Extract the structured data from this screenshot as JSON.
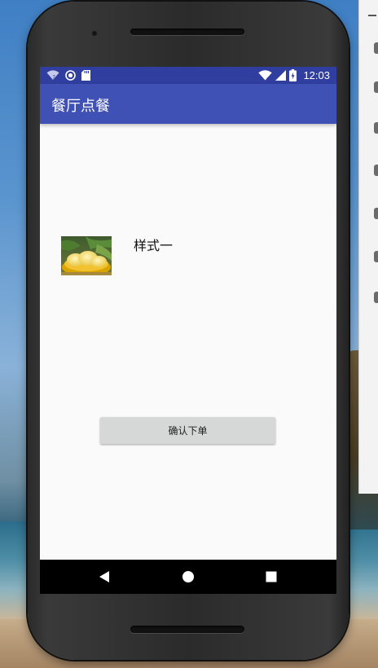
{
  "app": {
    "title": "餐厅点餐"
  },
  "status_bar": {
    "time": "12:03",
    "icons": [
      "wifi-question-icon",
      "sync-circle-icon",
      "sd-card-icon",
      "wifi-signal-icon",
      "cell-signal-icon",
      "battery-charging-icon"
    ]
  },
  "menu_item": {
    "image": "food-dish-image",
    "label": "样式一"
  },
  "order": {
    "confirm_label": "确认下单"
  },
  "nav": {
    "back_icon": "back-triangle-icon",
    "home_icon": "home-circle-icon",
    "recents_icon": "recents-square-icon"
  },
  "colors": {
    "status_bar": "#303f9f",
    "app_bar": "#3f51b5",
    "screen_bg": "#fafafa",
    "button_bg": "#d6d7d7"
  }
}
